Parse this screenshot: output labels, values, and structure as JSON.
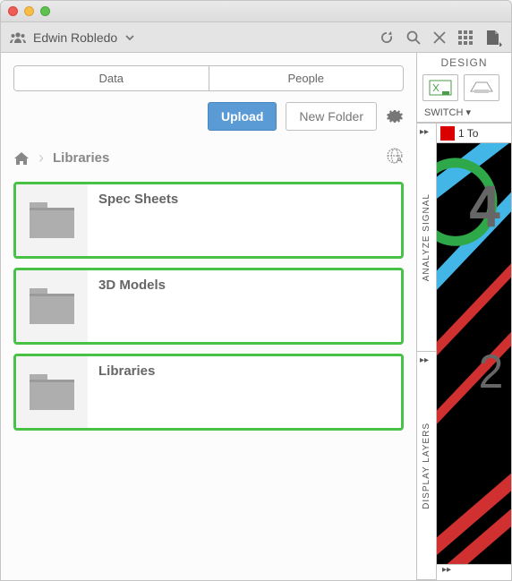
{
  "user": {
    "name": "Edwin Robledo"
  },
  "tabs": {
    "data": "Data",
    "people": "People"
  },
  "actions": {
    "upload": "Upload",
    "newFolder": "New Folder"
  },
  "breadcrumb": {
    "label": "Libraries"
  },
  "folders": [
    {
      "title": "Spec Sheets"
    },
    {
      "title": "3D Models"
    },
    {
      "title": "Libraries"
    }
  ],
  "right": {
    "header": "DESIGN",
    "switch": "SWITCH ▾",
    "layerLabel": "1 To",
    "rails": [
      "ANALYZE SIGNAL",
      "DISPLAY LAYERS"
    ],
    "canvasNumbers": [
      "4",
      "2"
    ]
  }
}
